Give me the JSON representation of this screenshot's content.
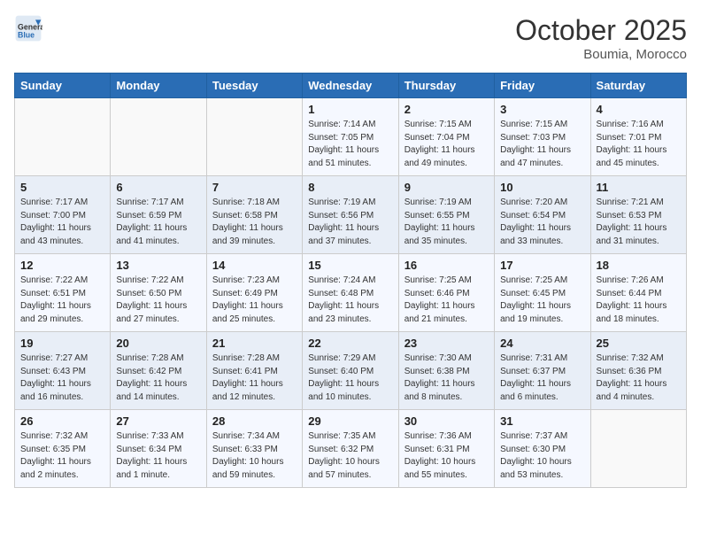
{
  "header": {
    "logo_general": "General",
    "logo_blue": "Blue",
    "month": "October 2025",
    "location": "Boumia, Morocco"
  },
  "days_of_week": [
    "Sunday",
    "Monday",
    "Tuesday",
    "Wednesday",
    "Thursday",
    "Friday",
    "Saturday"
  ],
  "weeks": [
    [
      {
        "day": "",
        "info": ""
      },
      {
        "day": "",
        "info": ""
      },
      {
        "day": "",
        "info": ""
      },
      {
        "day": "1",
        "info": "Sunrise: 7:14 AM\nSunset: 7:05 PM\nDaylight: 11 hours\nand 51 minutes."
      },
      {
        "day": "2",
        "info": "Sunrise: 7:15 AM\nSunset: 7:04 PM\nDaylight: 11 hours\nand 49 minutes."
      },
      {
        "day": "3",
        "info": "Sunrise: 7:15 AM\nSunset: 7:03 PM\nDaylight: 11 hours\nand 47 minutes."
      },
      {
        "day": "4",
        "info": "Sunrise: 7:16 AM\nSunset: 7:01 PM\nDaylight: 11 hours\nand 45 minutes."
      }
    ],
    [
      {
        "day": "5",
        "info": "Sunrise: 7:17 AM\nSunset: 7:00 PM\nDaylight: 11 hours\nand 43 minutes."
      },
      {
        "day": "6",
        "info": "Sunrise: 7:17 AM\nSunset: 6:59 PM\nDaylight: 11 hours\nand 41 minutes."
      },
      {
        "day": "7",
        "info": "Sunrise: 7:18 AM\nSunset: 6:58 PM\nDaylight: 11 hours\nand 39 minutes."
      },
      {
        "day": "8",
        "info": "Sunrise: 7:19 AM\nSunset: 6:56 PM\nDaylight: 11 hours\nand 37 minutes."
      },
      {
        "day": "9",
        "info": "Sunrise: 7:19 AM\nSunset: 6:55 PM\nDaylight: 11 hours\nand 35 minutes."
      },
      {
        "day": "10",
        "info": "Sunrise: 7:20 AM\nSunset: 6:54 PM\nDaylight: 11 hours\nand 33 minutes."
      },
      {
        "day": "11",
        "info": "Sunrise: 7:21 AM\nSunset: 6:53 PM\nDaylight: 11 hours\nand 31 minutes."
      }
    ],
    [
      {
        "day": "12",
        "info": "Sunrise: 7:22 AM\nSunset: 6:51 PM\nDaylight: 11 hours\nand 29 minutes."
      },
      {
        "day": "13",
        "info": "Sunrise: 7:22 AM\nSunset: 6:50 PM\nDaylight: 11 hours\nand 27 minutes."
      },
      {
        "day": "14",
        "info": "Sunrise: 7:23 AM\nSunset: 6:49 PM\nDaylight: 11 hours\nand 25 minutes."
      },
      {
        "day": "15",
        "info": "Sunrise: 7:24 AM\nSunset: 6:48 PM\nDaylight: 11 hours\nand 23 minutes."
      },
      {
        "day": "16",
        "info": "Sunrise: 7:25 AM\nSunset: 6:46 PM\nDaylight: 11 hours\nand 21 minutes."
      },
      {
        "day": "17",
        "info": "Sunrise: 7:25 AM\nSunset: 6:45 PM\nDaylight: 11 hours\nand 19 minutes."
      },
      {
        "day": "18",
        "info": "Sunrise: 7:26 AM\nSunset: 6:44 PM\nDaylight: 11 hours\nand 18 minutes."
      }
    ],
    [
      {
        "day": "19",
        "info": "Sunrise: 7:27 AM\nSunset: 6:43 PM\nDaylight: 11 hours\nand 16 minutes."
      },
      {
        "day": "20",
        "info": "Sunrise: 7:28 AM\nSunset: 6:42 PM\nDaylight: 11 hours\nand 14 minutes."
      },
      {
        "day": "21",
        "info": "Sunrise: 7:28 AM\nSunset: 6:41 PM\nDaylight: 11 hours\nand 12 minutes."
      },
      {
        "day": "22",
        "info": "Sunrise: 7:29 AM\nSunset: 6:40 PM\nDaylight: 11 hours\nand 10 minutes."
      },
      {
        "day": "23",
        "info": "Sunrise: 7:30 AM\nSunset: 6:38 PM\nDaylight: 11 hours\nand 8 minutes."
      },
      {
        "day": "24",
        "info": "Sunrise: 7:31 AM\nSunset: 6:37 PM\nDaylight: 11 hours\nand 6 minutes."
      },
      {
        "day": "25",
        "info": "Sunrise: 7:32 AM\nSunset: 6:36 PM\nDaylight: 11 hours\nand 4 minutes."
      }
    ],
    [
      {
        "day": "26",
        "info": "Sunrise: 7:32 AM\nSunset: 6:35 PM\nDaylight: 11 hours\nand 2 minutes."
      },
      {
        "day": "27",
        "info": "Sunrise: 7:33 AM\nSunset: 6:34 PM\nDaylight: 11 hours\nand 1 minute."
      },
      {
        "day": "28",
        "info": "Sunrise: 7:34 AM\nSunset: 6:33 PM\nDaylight: 10 hours\nand 59 minutes."
      },
      {
        "day": "29",
        "info": "Sunrise: 7:35 AM\nSunset: 6:32 PM\nDaylight: 10 hours\nand 57 minutes."
      },
      {
        "day": "30",
        "info": "Sunrise: 7:36 AM\nSunset: 6:31 PM\nDaylight: 10 hours\nand 55 minutes."
      },
      {
        "day": "31",
        "info": "Sunrise: 7:37 AM\nSunset: 6:30 PM\nDaylight: 10 hours\nand 53 minutes."
      },
      {
        "day": "",
        "info": ""
      }
    ]
  ]
}
